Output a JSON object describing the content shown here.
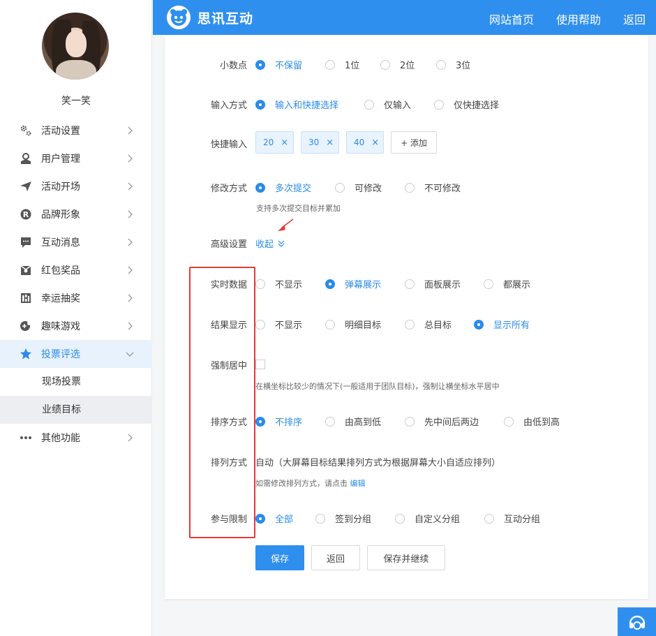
{
  "user": {
    "name": "笑一笑"
  },
  "sidebar": {
    "items": [
      {
        "label": "活动设置",
        "icon": "gears-icon"
      },
      {
        "label": "用户管理",
        "icon": "user-icon"
      },
      {
        "label": "活动开场",
        "icon": "paper-plane-icon"
      },
      {
        "label": "品牌形象",
        "icon": "registered-icon"
      },
      {
        "label": "互动消息",
        "icon": "chat-bubble-icon"
      },
      {
        "label": "红包奖品",
        "icon": "gift-box-icon"
      },
      {
        "label": "幸运抽奖",
        "icon": "lottery-icon"
      },
      {
        "label": "趣味游戏",
        "icon": "gamepad-icon"
      },
      {
        "label": "投票评选",
        "icon": "star-icon"
      },
      {
        "label": "其他功能",
        "icon": "more-dots-icon"
      }
    ],
    "subitems": [
      {
        "label": "现场投票"
      },
      {
        "label": "业绩目标"
      }
    ]
  },
  "header": {
    "brand": "思讯互动",
    "nav": [
      {
        "label": "网站首页"
      },
      {
        "label": "使用帮助"
      },
      {
        "label": "返回"
      }
    ],
    "color": "#2f8fee"
  },
  "form": {
    "decimal": {
      "label": "小数点",
      "options": [
        "不保留",
        "1位",
        "2位",
        "3位"
      ],
      "selected": "不保留"
    },
    "input_mode": {
      "label": "输入方式",
      "options": [
        "输入和快捷选择",
        "仅输入",
        "仅快捷选择"
      ],
      "selected": "输入和快捷选择"
    },
    "quick_input": {
      "label": "快捷输入",
      "tags": [
        "20",
        "30",
        "40"
      ],
      "remove": "×",
      "add_label": "+ 添加"
    },
    "modify": {
      "label": "修改方式",
      "options": [
        "多次提交",
        "可修改",
        "不可修改"
      ],
      "selected": "多次提交",
      "hint": "支持多次提交目标并累加"
    },
    "advanced": {
      "label": "高级设置",
      "toggle": "收起"
    },
    "realtime": {
      "label": "实时数据",
      "options": [
        "不显示",
        "弹幕展示",
        "面板展示",
        "都展示"
      ],
      "selected": "弹幕展示"
    },
    "result": {
      "label": "结果显示",
      "options": [
        "不显示",
        "明细目标",
        "总目标",
        "显示所有"
      ],
      "selected": "显示所有"
    },
    "center": {
      "label": "强制居中",
      "hint": "在横坐标比较少的情况下(一般适用于团队目标)，强制让横坐标水平居中"
    },
    "sort": {
      "label": "排序方式",
      "options": [
        "不排序",
        "由高到低",
        "先中间后两边",
        "由低到高"
      ],
      "selected": "不排序"
    },
    "arrange": {
      "label": "排列方式",
      "value": "自动（大屏幕目标结果排列方式为根据屏幕大小自适应排列）",
      "hint": "如需修改排列方式，请点击",
      "edit": "编辑"
    },
    "limit": {
      "label": "参与限制",
      "options": [
        "全部",
        "签到分组",
        "自定义分组",
        "互动分组"
      ],
      "selected": "全部"
    }
  },
  "buttons": {
    "save": "保存",
    "back": "返回",
    "save_continue": "保存并继续"
  },
  "accent": "#2b8be8",
  "highlight_color": "#e53935"
}
